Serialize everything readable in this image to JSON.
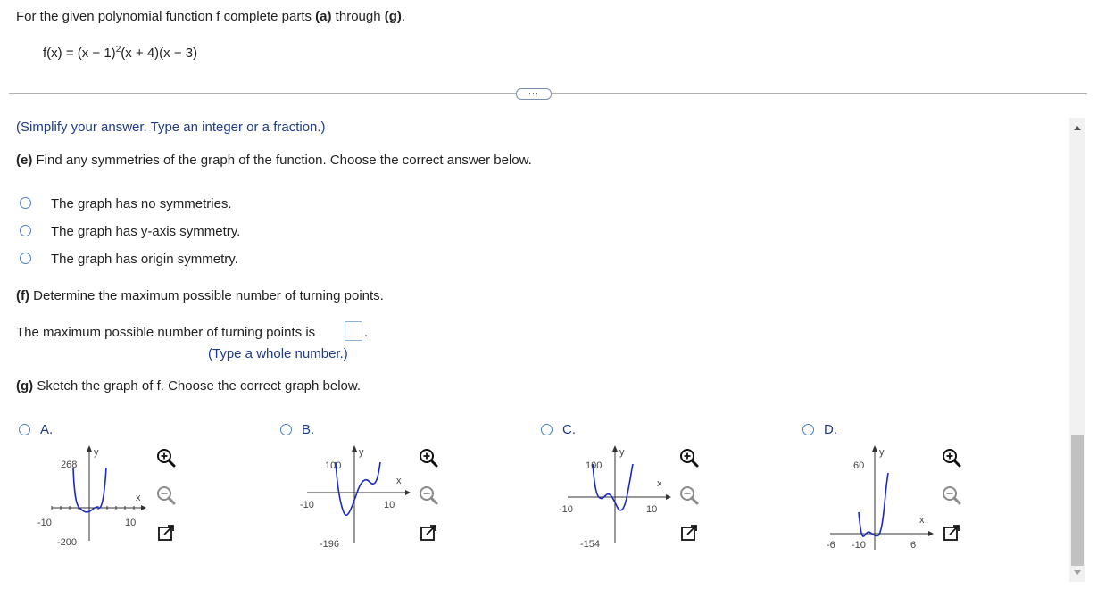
{
  "header": {
    "instruction_pre": "For the given polynomial function f complete parts ",
    "a": "(a)",
    "through": " through ",
    "g": "(g)",
    "dot": ".",
    "formula_left": "f(x) = (x − 1)",
    "formula_exp": "2",
    "formula_right": "(x + 4)(x − 3)"
  },
  "expand_button": "···",
  "simplify_hint": "(Simplify your answer. Type an integer or a fraction.)",
  "part_e": {
    "label": "(e)",
    "question": " Find any symmetries of the graph of the function. Choose the correct answer below.",
    "options": [
      "The graph has no symmetries.",
      "The graph has y-axis symmetry.",
      "The graph has origin symmetry."
    ]
  },
  "part_f": {
    "label": "(f)",
    "question": " Determine the maximum possible number of turning points.",
    "answer_prefix": "The maximum possible number of turning points is",
    "answer_suffix": ".",
    "hint": "(Type a whole number.)"
  },
  "part_g": {
    "label": "(g)",
    "question": " Sketch the graph of f. Choose the correct graph below.",
    "options": [
      {
        "letter": "A.",
        "y_top": "268",
        "y_bottom": "-200",
        "x_left": "-10",
        "x_right": "10",
        "x_label": "x",
        "y_label": "y"
      },
      {
        "letter": "B.",
        "y_top": "100",
        "y_bottom": "-196",
        "x_left": "-10",
        "x_right": "10",
        "x_label": "x",
        "y_label": "y"
      },
      {
        "letter": "C.",
        "y_top": "100",
        "y_bottom": "-154",
        "x_left": "-10",
        "x_right": "10",
        "x_label": "x",
        "y_label": "y"
      },
      {
        "letter": "D.",
        "y_top": "60",
        "y_bottom": "-10",
        "x_left": "-6",
        "x_right": "6",
        "x_label": "x",
        "y_label": "y"
      }
    ]
  },
  "icons": {
    "zoom_in": "zoom-in-icon",
    "zoom_out": "zoom-out-icon",
    "popout": "popout-icon"
  },
  "colors": {
    "accent": "#1f3c88",
    "radio": "#4a7fc0",
    "curve": "#1a2bbd"
  }
}
